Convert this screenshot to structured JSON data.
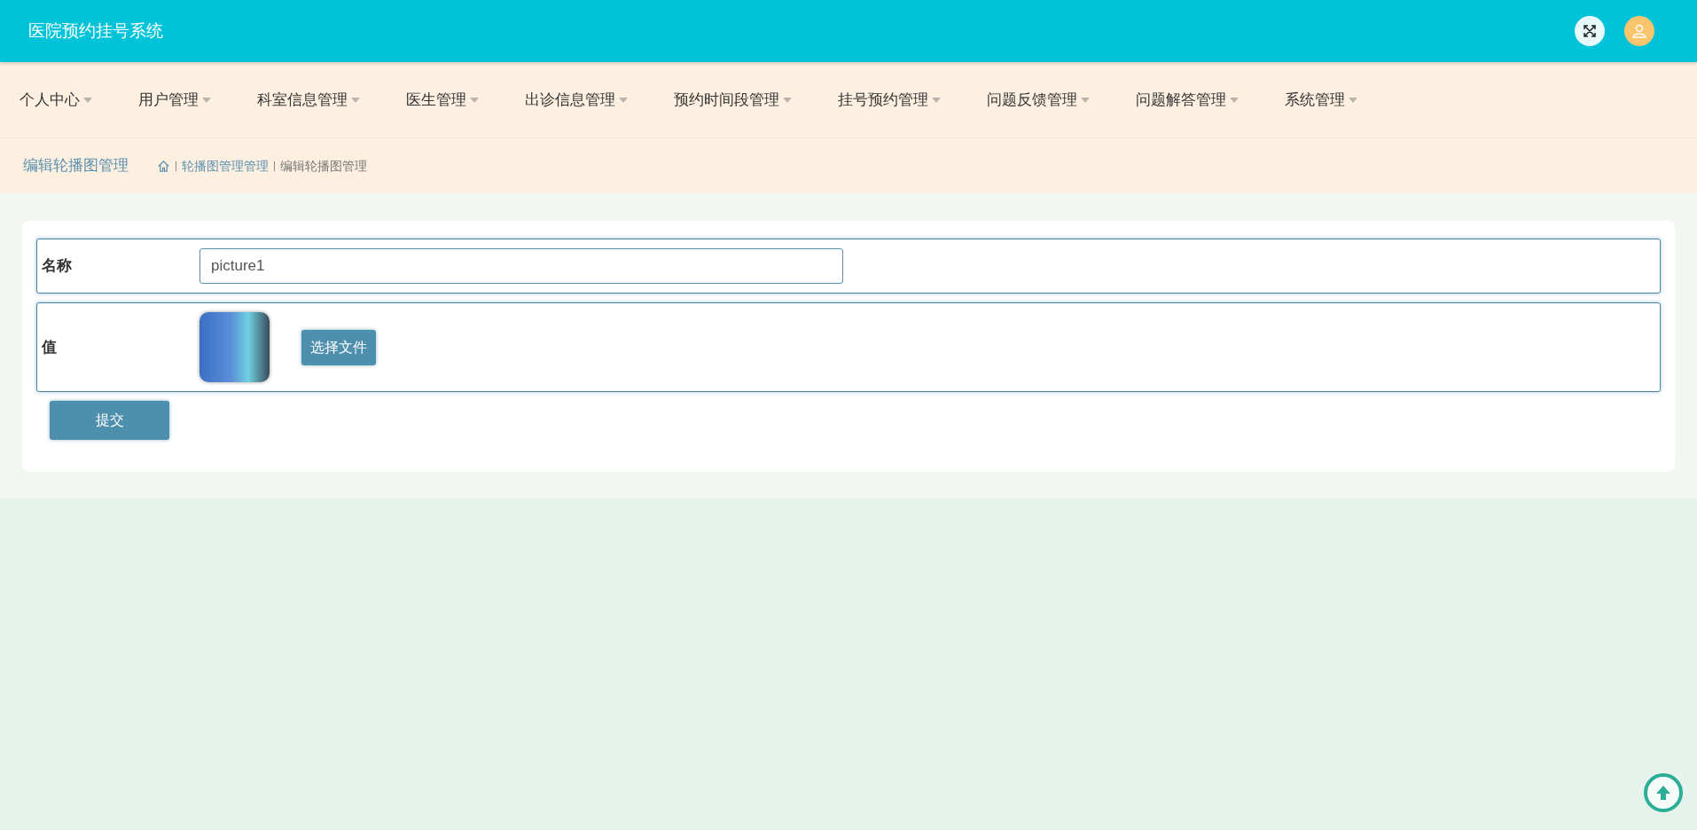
{
  "header": {
    "title": "医院预约挂号系统"
  },
  "nav": [
    {
      "label": "个人中心"
    },
    {
      "label": "用户管理"
    },
    {
      "label": "科室信息管理"
    },
    {
      "label": "医生管理"
    },
    {
      "label": "出诊信息管理"
    },
    {
      "label": "预约时间段管理"
    },
    {
      "label": "挂号预约管理"
    },
    {
      "label": "问题反馈管理"
    },
    {
      "label": "问题解答管理"
    },
    {
      "label": "系统管理"
    }
  ],
  "breadcrumb": {
    "title": "编辑轮播图管理",
    "items": [
      "轮播图管理管理",
      "编辑轮播图管理"
    ]
  },
  "form": {
    "fields": [
      {
        "kind": "text",
        "label": "名称",
        "value": "picture1"
      },
      {
        "kind": "file",
        "label": "值",
        "button": "选择文件"
      }
    ],
    "submit": "提交"
  }
}
